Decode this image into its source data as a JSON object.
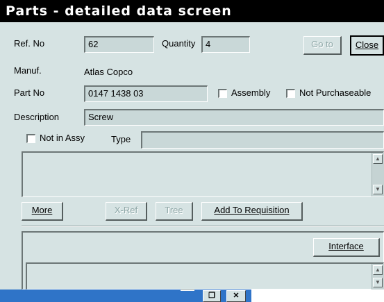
{
  "window": {
    "title": "Parts - detailed data screen"
  },
  "fields": {
    "ref_no": {
      "label": "Ref. No",
      "value": "62"
    },
    "quantity": {
      "label": "Quantity",
      "value": "4"
    },
    "manufacturer": {
      "label": "Manuf.",
      "value": "Atlas Copco"
    },
    "part_no": {
      "label": "Part No",
      "value": "0147 1438 03"
    },
    "description": {
      "label": "Description",
      "value": "Screw"
    },
    "type": {
      "label": "Type",
      "value": ""
    }
  },
  "checkboxes": {
    "assembly": {
      "label": "Assembly",
      "checked": false
    },
    "not_purchaseable": {
      "label": "Not Purchaseable",
      "checked": false
    },
    "not_in_assy": {
      "label": "Not in Assy",
      "checked": false
    }
  },
  "buttons": {
    "go_to": "Go to",
    "close": "Close",
    "more": "More",
    "x_ref": "X-Ref",
    "tree": "Tree",
    "add_to_requisition": "Add To Requisition",
    "interface": "Interface"
  },
  "scrollbar": {
    "up_icon": "arrow-up-icon",
    "down_icon": "arrow-down-icon",
    "up_glyph": "▲",
    "down_glyph": "▼"
  },
  "window_controls": {
    "restore_glyph": "❐",
    "close_glyph": "✕"
  },
  "colors": {
    "window_bg": "#d6e3e3",
    "titlebar_bg": "#000000",
    "taskbar": "#2f74c8"
  }
}
